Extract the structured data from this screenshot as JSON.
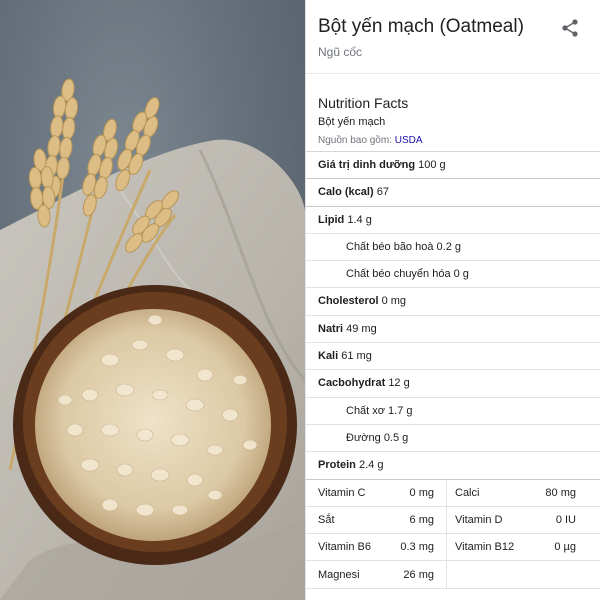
{
  "food": {
    "title": "Bột yến mạch (Oatmeal)",
    "category": "Ngũ cốc"
  },
  "facts": {
    "heading": "Nutrition Facts",
    "food_name": "Bột yến mạch",
    "source_prefix": "Nguồn bao gồm:",
    "source_link": "USDA"
  },
  "rows": {
    "serving_label": "Giá trị dinh dưỡng",
    "serving_value": "100 g",
    "calories_label": "Calo (kcal)",
    "calories_value": "67",
    "lipid_label": "Lipid",
    "lipid_value": "1.4 g",
    "sat_fat": "Chất béo bão hoà 0.2 g",
    "trans_fat": "Chất béo chuyển hóa 0 g",
    "cholesterol_label": "Cholesterol",
    "cholesterol_value": "0 mg",
    "sodium_label": "Natri",
    "sodium_value": "49 mg",
    "potassium_label": "Kali",
    "potassium_value": "61 mg",
    "carb_label": "Cacbohydrat",
    "carb_value": "12 g",
    "fiber": "Chất xơ 1.7 g",
    "sugar": "Đường 0.5 g",
    "protein_label": "Protein",
    "protein_value": "2.4 g"
  },
  "vitamins": [
    {
      "l1": "Vitamin C",
      "v1": "0 mg",
      "l2": "Calci",
      "v2": "80 mg"
    },
    {
      "l1": "Sắt",
      "v1": "6 mg",
      "l2": "Vitamin D",
      "v2": "0 IU"
    },
    {
      "l1": "Vitamin B6",
      "v1": "0.3 mg",
      "l2": "Vitamin B12",
      "v2": "0 µg"
    },
    {
      "l1": "Magnesi",
      "v1": "26 mg",
      "l2": "",
      "v2": ""
    }
  ],
  "icons": {
    "share": "share-icon"
  },
  "colors": {
    "link": "#1a0dab",
    "muted": "#70757a",
    "text": "#202124"
  }
}
